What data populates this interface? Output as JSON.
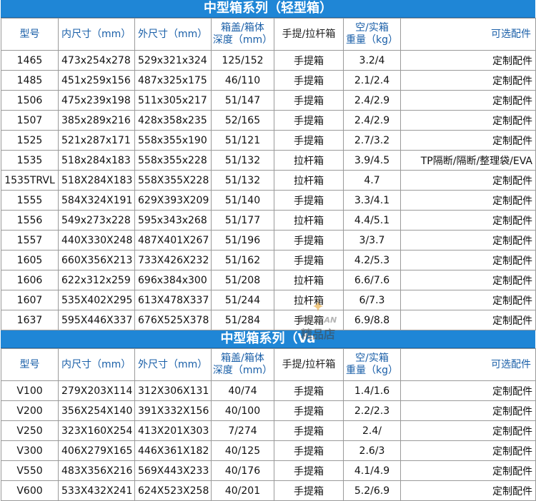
{
  "sections": [
    {
      "title": "中型箱系列（轻型箱）",
      "headers": [
        "型号",
        "内尺寸（mm）",
        "外尺寸（mm）",
        "箱盖/箱体\n深度（mm）",
        "手提/拉杆箱",
        "空/实箱\n重量（kg）",
        "可选配件"
      ],
      "rows": [
        [
          "1465",
          "473x254x278",
          "529x321x324",
          "125/152",
          "手提箱",
          "3.2/4",
          "定制配件"
        ],
        [
          "1485",
          "451x259x156",
          "487x325x175",
          "46/110",
          "手提箱",
          "2.1/2.4",
          "定制配件"
        ],
        [
          "1506",
          "475x239x198",
          "511x305x217",
          "51/147",
          "手提箱",
          "2.4/2.9",
          "定制配件"
        ],
        [
          "1507",
          "385x289x216",
          "428x358x235",
          "52/165",
          "手提箱",
          "2.4/2.9",
          "定制配件"
        ],
        [
          "1525",
          "521x287x171",
          "558x355x190",
          "51/121",
          "手提箱",
          "2.7/3.2",
          "定制配件"
        ],
        [
          "1535",
          "518x284x183",
          "558x355x228",
          "51/132",
          "拉杆箱",
          "3.9/4.5",
          "TP隔断/隔断/整理袋/EVA"
        ],
        [
          "1535TRVL",
          "518X284X183",
          "558X355X228",
          "51/132",
          "拉杆箱",
          "4.7",
          "定制配件"
        ],
        [
          "1555",
          "584X324X191",
          "629X393X209",
          "51/140",
          "手提箱",
          "3.3/4.1",
          "定制配件"
        ],
        [
          "1556",
          "549x273x228",
          "595x343x268",
          "51/177",
          "拉杆箱",
          "4.4/5.1",
          "定制配件"
        ],
        [
          "1557",
          "440X330X248",
          "487X401X267",
          "51/196",
          "手提箱",
          "3/3.7",
          "定制配件"
        ],
        [
          "1605",
          "660X356X213",
          "733X426X232",
          "51/162",
          "手提箱",
          "4.2/5.3",
          "定制配件"
        ],
        [
          "1606",
          "622x312x259",
          "696x384x300",
          "51/208",
          "拉杆箱",
          "6.6/7.6",
          "定制配件"
        ],
        [
          "1607",
          "535X402X295",
          "613X478X337",
          "51/244",
          "拉杆箱",
          "6/7.3",
          "定制配件"
        ],
        [
          "1637",
          "595X446X337",
          "676X525X378",
          "51/284",
          "手提箱",
          "6.9/8.8",
          "定制配件"
        ]
      ]
    },
    {
      "title": "中型箱系列（Va",
      "headers": [
        "型号",
        "内尺寸（mm）",
        "外尺寸（mm）",
        "箱盖/箱体\n深度（mm）",
        "手提/拉杆箱",
        "空/实箱\n重量（kg）",
        "可选配件"
      ],
      "rows": [
        [
          "V100",
          "279X203X114",
          "312X306X131",
          "40/74",
          "手提箱",
          "1.4/1.6",
          "定制配件"
        ],
        [
          "V200",
          "356X254X140",
          "391X332X156",
          "40/100",
          "手提箱",
          "2.2/2.3",
          "定制配件"
        ],
        [
          "V250",
          "323X160X254",
          "413X201X303",
          "7/274",
          "手提箱",
          "2.4/",
          "定制配件"
        ],
        [
          "V300",
          "406X279X165",
          "446X361X182",
          "40/125",
          "手提箱",
          "2.6/3",
          "定制配件"
        ],
        [
          "V550",
          "483X356X216",
          "569X443X233",
          "40/176",
          "手提箱",
          "4.1/4.9",
          "定制配件"
        ],
        [
          "V600",
          "533X432X241",
          "624X523X258",
          "40/201",
          "手提箱",
          "5.2/6.9",
          "定制配件"
        ]
      ]
    }
  ],
  "watermark": {
    "brand": "PELICAN",
    "text": "精品店"
  },
  "colors": {
    "header_bar": "#1f86d6",
    "model_text": "#1f6fc9",
    "trolley_text": "#1f78d0"
  }
}
